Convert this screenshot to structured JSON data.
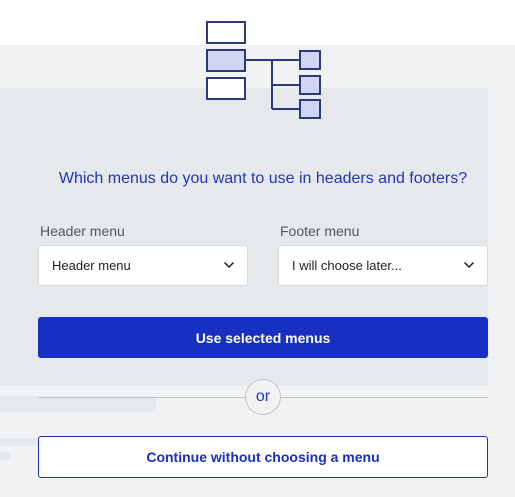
{
  "illustration": {
    "icon": "menu-tree-icon",
    "stroke_color": "#2a3a7a",
    "fill_color": "#cfd5f2"
  },
  "question": "Which menus do you want to use in headers and footers?",
  "header_menu": {
    "label": "Header menu",
    "selected": "Header menu"
  },
  "footer_menu": {
    "label": "Footer menu",
    "selected": "I will choose later..."
  },
  "primary_action": "Use selected menus",
  "divider_text": "or",
  "secondary_action": "Continue without choosing a menu",
  "colors": {
    "accent": "#1730c1",
    "question_text": "#2234c0",
    "panel_bg": "#e6e9ec",
    "page_bg": "#f0f2f4"
  }
}
